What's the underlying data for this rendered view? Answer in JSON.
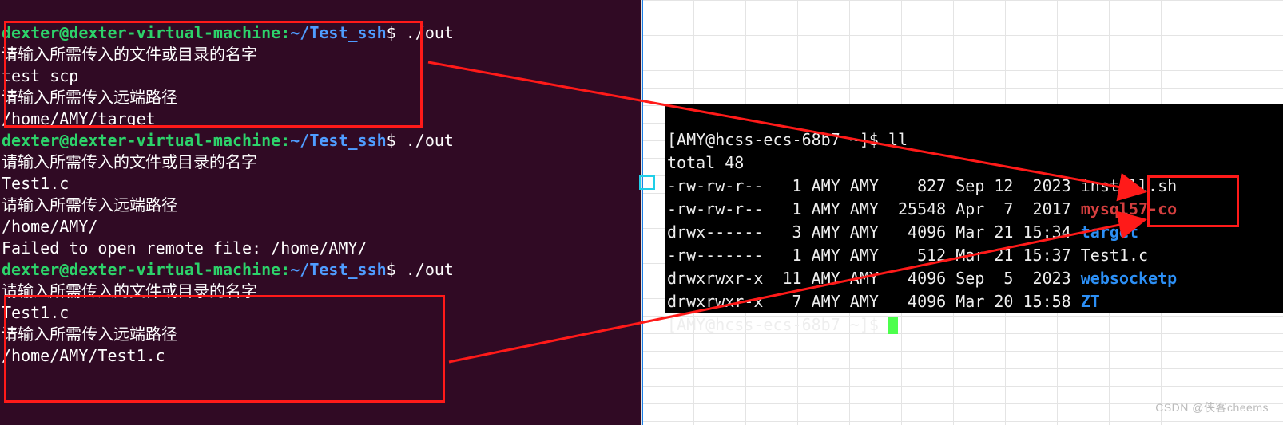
{
  "left": {
    "prompt_user": "dexter@dexter-virtual-machine",
    "prompt_sep": ":",
    "prompt_path": "~/Test_ssh",
    "prompt_dollar": "$",
    "cmd": "./out",
    "ask_file": "请输入所需传入的文件或目录的名字",
    "ask_path": "请输入所需传入远端路径",
    "run1_file": "test_scp",
    "run1_path": "/home/AMY/target",
    "run2_file": "Test1.c",
    "run2_path": "/home/AMY/",
    "run2_err": "Failed to open remote file: /home/AMY/",
    "run3_file": "Test1.c",
    "run3_path": "/home/AMY/Test1.c"
  },
  "right": {
    "prompt": "[AMY@hcss-ecs-68b7 ~]$",
    "cmd": "ll",
    "total": "total 48",
    "rows": [
      {
        "perm": "-rw-rw-r--",
        "links": "1",
        "owner": "AMY",
        "group": "AMY",
        "size": "827",
        "date": "Sep 12  2023",
        "name": "install.sh",
        "cls": ""
      },
      {
        "perm": "-rw-rw-r--",
        "links": "1",
        "owner": "AMY",
        "group": "AMY",
        "size": "25548",
        "date": "Apr  7  2017",
        "name": "mysql57-co",
        "cls": "red"
      },
      {
        "perm": "drwx------",
        "links": "3",
        "owner": "AMY",
        "group": "AMY",
        "size": "4096",
        "date": "Mar 21 15:34",
        "name": "target",
        "cls": "dir"
      },
      {
        "perm": "-rw-------",
        "links": "1",
        "owner": "AMY",
        "group": "AMY",
        "size": "512",
        "date": "Mar 21 15:37",
        "name": "Test1.c",
        "cls": ""
      },
      {
        "perm": "drwxrwxr-x",
        "links": "11",
        "owner": "AMY",
        "group": "AMY",
        "size": "4096",
        "date": "Sep  5  2023",
        "name": "websocketp",
        "cls": "dir"
      },
      {
        "perm": "drwxrwxr-x",
        "links": "7",
        "owner": "AMY",
        "group": "AMY",
        "size": "4096",
        "date": "Mar 20 15:58",
        "name": "ZT",
        "cls": "dir"
      }
    ]
  },
  "watermark": "CSDN @侠客cheems"
}
